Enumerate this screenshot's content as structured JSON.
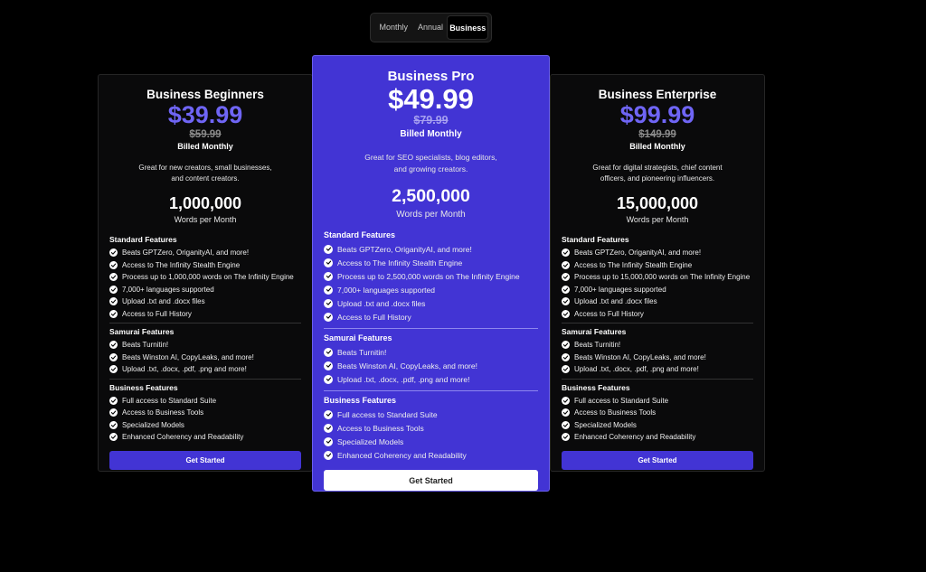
{
  "toggle": {
    "monthly": "Monthly",
    "annual": "Annual",
    "business": "Business"
  },
  "section_titles": {
    "standard": "Standard Features",
    "samurai": "Samurai Features",
    "business": "Business Features"
  },
  "cta_label": "Get Started",
  "accent_color": "#4234d4",
  "plans": {
    "beginners": {
      "title": "Business Beginners",
      "price": "$39.99",
      "old_price": "$59.99",
      "billed": "Billed Monthly",
      "desc": "Great for new creators, small businesses, and content creators.",
      "words": "1,000,000",
      "words_label": "Words per Month",
      "standard": [
        "Beats GPTZero, OriganityAI, and more!",
        "Access to The Infinity Stealth Engine",
        "Process up to 1,000,000 words on The Infinity Engine",
        "7,000+ languages supported",
        "Upload .txt and .docx files",
        "Access to Full History"
      ],
      "samurai": [
        "Beats Turnitin!",
        "Beats Winston AI, CopyLeaks, and more!",
        "Upload .txt, .docx, .pdf, .png and more!"
      ],
      "business": [
        "Full access to Standard Suite",
        "Access to Business Tools",
        "Specialized Models",
        "Enhanced Coherency and Readability"
      ]
    },
    "pro": {
      "title": "Business Pro",
      "price": "$49.99",
      "old_price": "$79.99",
      "billed": "Billed Monthly",
      "desc": "Great for SEO specialists, blog editors, and growing creators.",
      "words": "2,500,000",
      "words_label": "Words per Month",
      "standard": [
        "Beats GPTZero, OriganityAI, and more!",
        "Access to The Infinity Stealth Engine",
        "Process up to 2,500,000 words on The Infinity Engine",
        "7,000+ languages supported",
        "Upload .txt and .docx files",
        "Access to Full History"
      ],
      "samurai": [
        "Beats Turnitin!",
        "Beats Winston AI, CopyLeaks, and more!",
        "Upload .txt, .docx, .pdf, .png and more!"
      ],
      "business": [
        "Full access to Standard Suite",
        "Access to Business Tools",
        "Specialized Models",
        "Enhanced Coherency and Readability"
      ]
    },
    "enterprise": {
      "title": "Business Enterprise",
      "price": "$99.99",
      "old_price": "$149.99",
      "billed": "Billed Monthly",
      "desc": "Great for digital strategists, chief content officers, and pioneering influencers.",
      "words": "15,000,000",
      "words_label": "Words per Month",
      "standard": [
        "Beats GPTZero, OriganityAI, and more!",
        "Access to The Infinity Stealth Engine",
        "Process up to 15,000,000 words on The Infinity Engine",
        "7,000+ languages supported",
        "Upload .txt and .docx files",
        "Access to Full History"
      ],
      "samurai": [
        "Beats Turnitin!",
        "Beats Winston AI, CopyLeaks, and more!",
        "Upload .txt, .docx, .pdf, .png and more!"
      ],
      "business": [
        "Full access to Standard Suite",
        "Access to Business Tools",
        "Specialized Models",
        "Enhanced Coherency and Readability"
      ]
    }
  }
}
